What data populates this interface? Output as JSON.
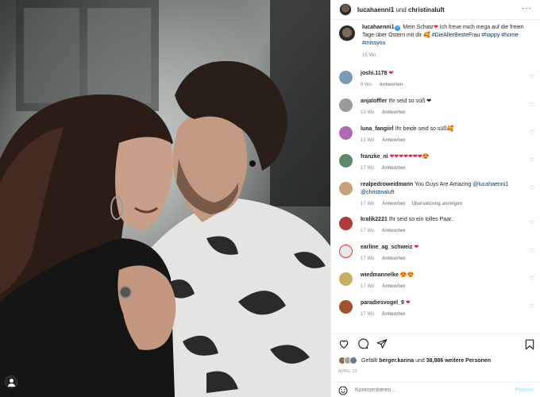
{
  "header": {
    "user1": "lucahaenni1",
    "connector": " und ",
    "user2": "christinaluft"
  },
  "caption": {
    "username": "lucahaenni1",
    "verified_mark": "✓",
    "text_before_heart": " Mein Schatz",
    "heart": "❤",
    "text_main": " Ich freue mich mega auf die freien Tage über Ostern mit dir 🥰",
    "hashtags": [
      "#DieAllerBesteFrau",
      "#happy",
      "#home",
      "#missyou"
    ],
    "time": "18 Wo."
  },
  "comments": [
    {
      "username": "joshi.1178",
      "text": " ❤",
      "time": "8 Wo.",
      "reply": "Antworten",
      "avatar_color": "#7a9ab8"
    },
    {
      "username": "anjaloffler",
      "text": " Ihr seid so süß ❤",
      "time": "13 Wo.",
      "reply": "Antworten",
      "avatar_color": "#9a9a9a"
    },
    {
      "username": "luna_fangiirl",
      "text": " Ihr beide seid so süß🥰",
      "time": "13 Wo.",
      "reply": "Antworten",
      "avatar_color": "#b06ab3"
    },
    {
      "username": "franzke_ni",
      "text": " ❤❤❤❤❤❤❤😍",
      "time": "17 Wo.",
      "reply": "Antworten",
      "avatar_color": "#5a8a6a"
    },
    {
      "username": "realpedroweidmann",
      "text": " You Guys Are Amazing ",
      "mention1": "@lucahaenni1",
      "mention2": "@christinaluft",
      "time": "17 Wo.",
      "reply": "Antworten",
      "translate": "Übersetzung anzeigen",
      "avatar_color": "#c9a27a"
    },
    {
      "username": "kralik2221",
      "text": " Ihr seid so ein tolles Paar..",
      "time": "17 Wo.",
      "reply": "Antworten",
      "avatar_color": "#b23a3a"
    },
    {
      "username": "earline_ag_schweiz",
      "text": " ❤",
      "time": "17 Wo.",
      "reply": "Antworten",
      "avatar_color": "#e8e8e8"
    },
    {
      "username": "wiedmannelke",
      "text": " 😍😍",
      "time": "17 Wo.",
      "reply": "Antworten",
      "avatar_color": "#c8b060"
    },
    {
      "username": "paradiesvogel_9",
      "text": " ❤",
      "time": "17 Wo.",
      "reply": "Antworten",
      "avatar_color": "#a0522d"
    }
  ],
  "likes": {
    "prefix": "Gefällt ",
    "user": "berger.karina",
    "middle": " und ",
    "count": "38,886 weitere Personen"
  },
  "date": "APRIL 13",
  "add_comment": {
    "placeholder": "Kommentieren ...",
    "post_label": "Posten"
  },
  "icons": [
    "heart-icon",
    "comment-icon",
    "share-icon",
    "bookmark-icon",
    "emoji-icon",
    "more-icon"
  ],
  "colors": {
    "link": "#00376b",
    "verified": "#3897f0",
    "heart": "#ed1c39",
    "muted": "#8e8e8e",
    "post_disabled": "#b2dffc"
  }
}
